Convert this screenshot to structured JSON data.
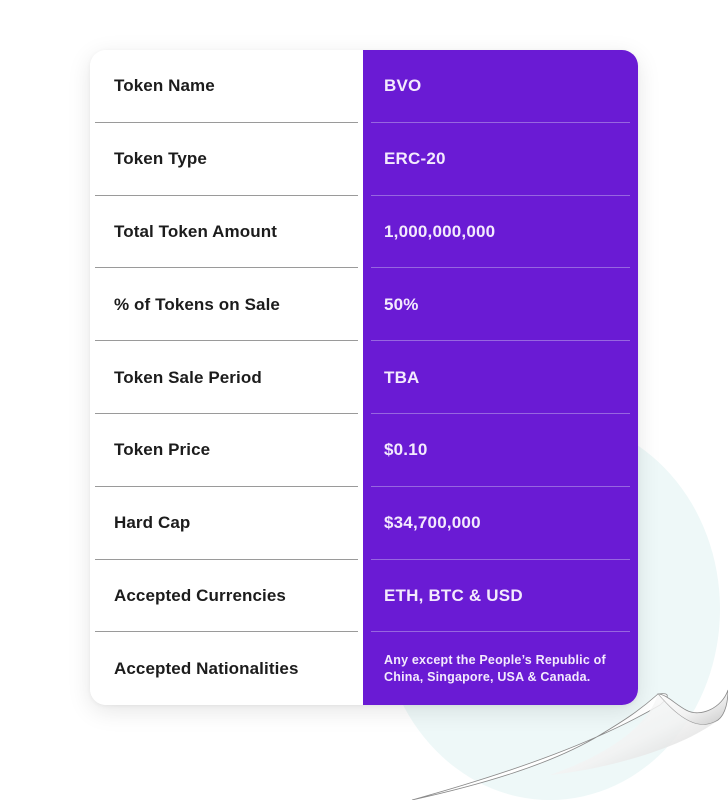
{
  "token_details": {
    "rows": [
      {
        "label": "Token Name",
        "value": "BVO"
      },
      {
        "label": "Token Type",
        "value": "ERC-20"
      },
      {
        "label": "Total Token Amount",
        "value": "1,000,000,000"
      },
      {
        "label": "% of Tokens on Sale",
        "value": "50%"
      },
      {
        "label": "Token Sale Period",
        "value": "TBA"
      },
      {
        "label": "Token Price",
        "value": "$0.10"
      },
      {
        "label": "Hard Cap",
        "value": "$34,700,000"
      },
      {
        "label": "Accepted Currencies",
        "value": "ETH, BTC & USD"
      },
      {
        "label": "Accepted Nationalities",
        "value": "Any except the People’s Republic of China, Singapore, USA & Canada."
      }
    ]
  },
  "colors": {
    "accent": "#6a1bd4",
    "label_text": "#1c1c1c",
    "value_text": "#f3eafd",
    "background_circle": "#eef8f8"
  }
}
